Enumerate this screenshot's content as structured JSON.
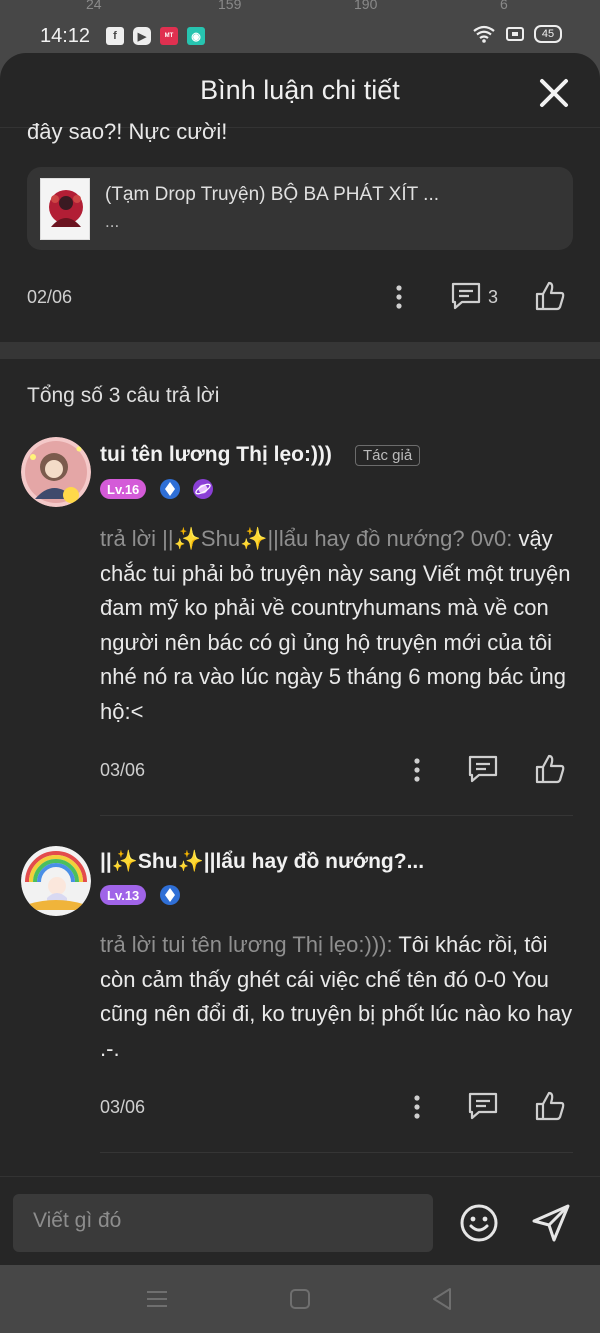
{
  "status_bar": {
    "time": "14:12",
    "battery": "45",
    "background_numbers": [
      "24",
      "159",
      "190",
      "6"
    ]
  },
  "sheet": {
    "title": "Bình luận chi tiết",
    "close_icon": "close-icon"
  },
  "original_comment": {
    "text_tail": "đây sao?! Nực cười!",
    "story_card": {
      "title": "(Tạm Drop Truyện) BỘ BA PHÁT XÍT ...",
      "subtitle": "..."
    },
    "date": "02/06",
    "reply_count": "3"
  },
  "replies_header": "Tổng số 3 câu trả lời",
  "replies": [
    {
      "username": "tui tên lương Thị lẹo:)))",
      "author_tag": "Tác giả",
      "level": "Lv.16",
      "reply_to": "trả lời ||✨Shu✨||lẩu hay đồ nướng? 0v0:",
      "text": " vậy chắc tui phải bỏ truyện này sang Viết một truyện đam mỹ ko phải về countryhumans mà về con người nên bác có gì ủng hộ truyện mới của tôi nhé nó ra vào lúc ngày 5 tháng 6 mong bác ủng hộ:<",
      "date": "03/06"
    },
    {
      "username": "||✨Shu✨||lẩu hay đồ nướng?...",
      "level": "Lv.13",
      "reply_to": "trả lời tui tên lương Thị lẹo:))):",
      "text": " Tôi khác rồi, tôi còn cảm thấy ghét cái việc chế tên đó 0-0 You cũng nên đổi đi, ko truyện bị phốt lúc nào ko hay .-.",
      "date": "03/06"
    }
  ],
  "composer": {
    "placeholder": "Viết gì đó"
  },
  "colors": {
    "sheet_bg": "#262626",
    "page_bg": "#474747",
    "level16": "#d45bd8",
    "level13": "#a064e8"
  }
}
